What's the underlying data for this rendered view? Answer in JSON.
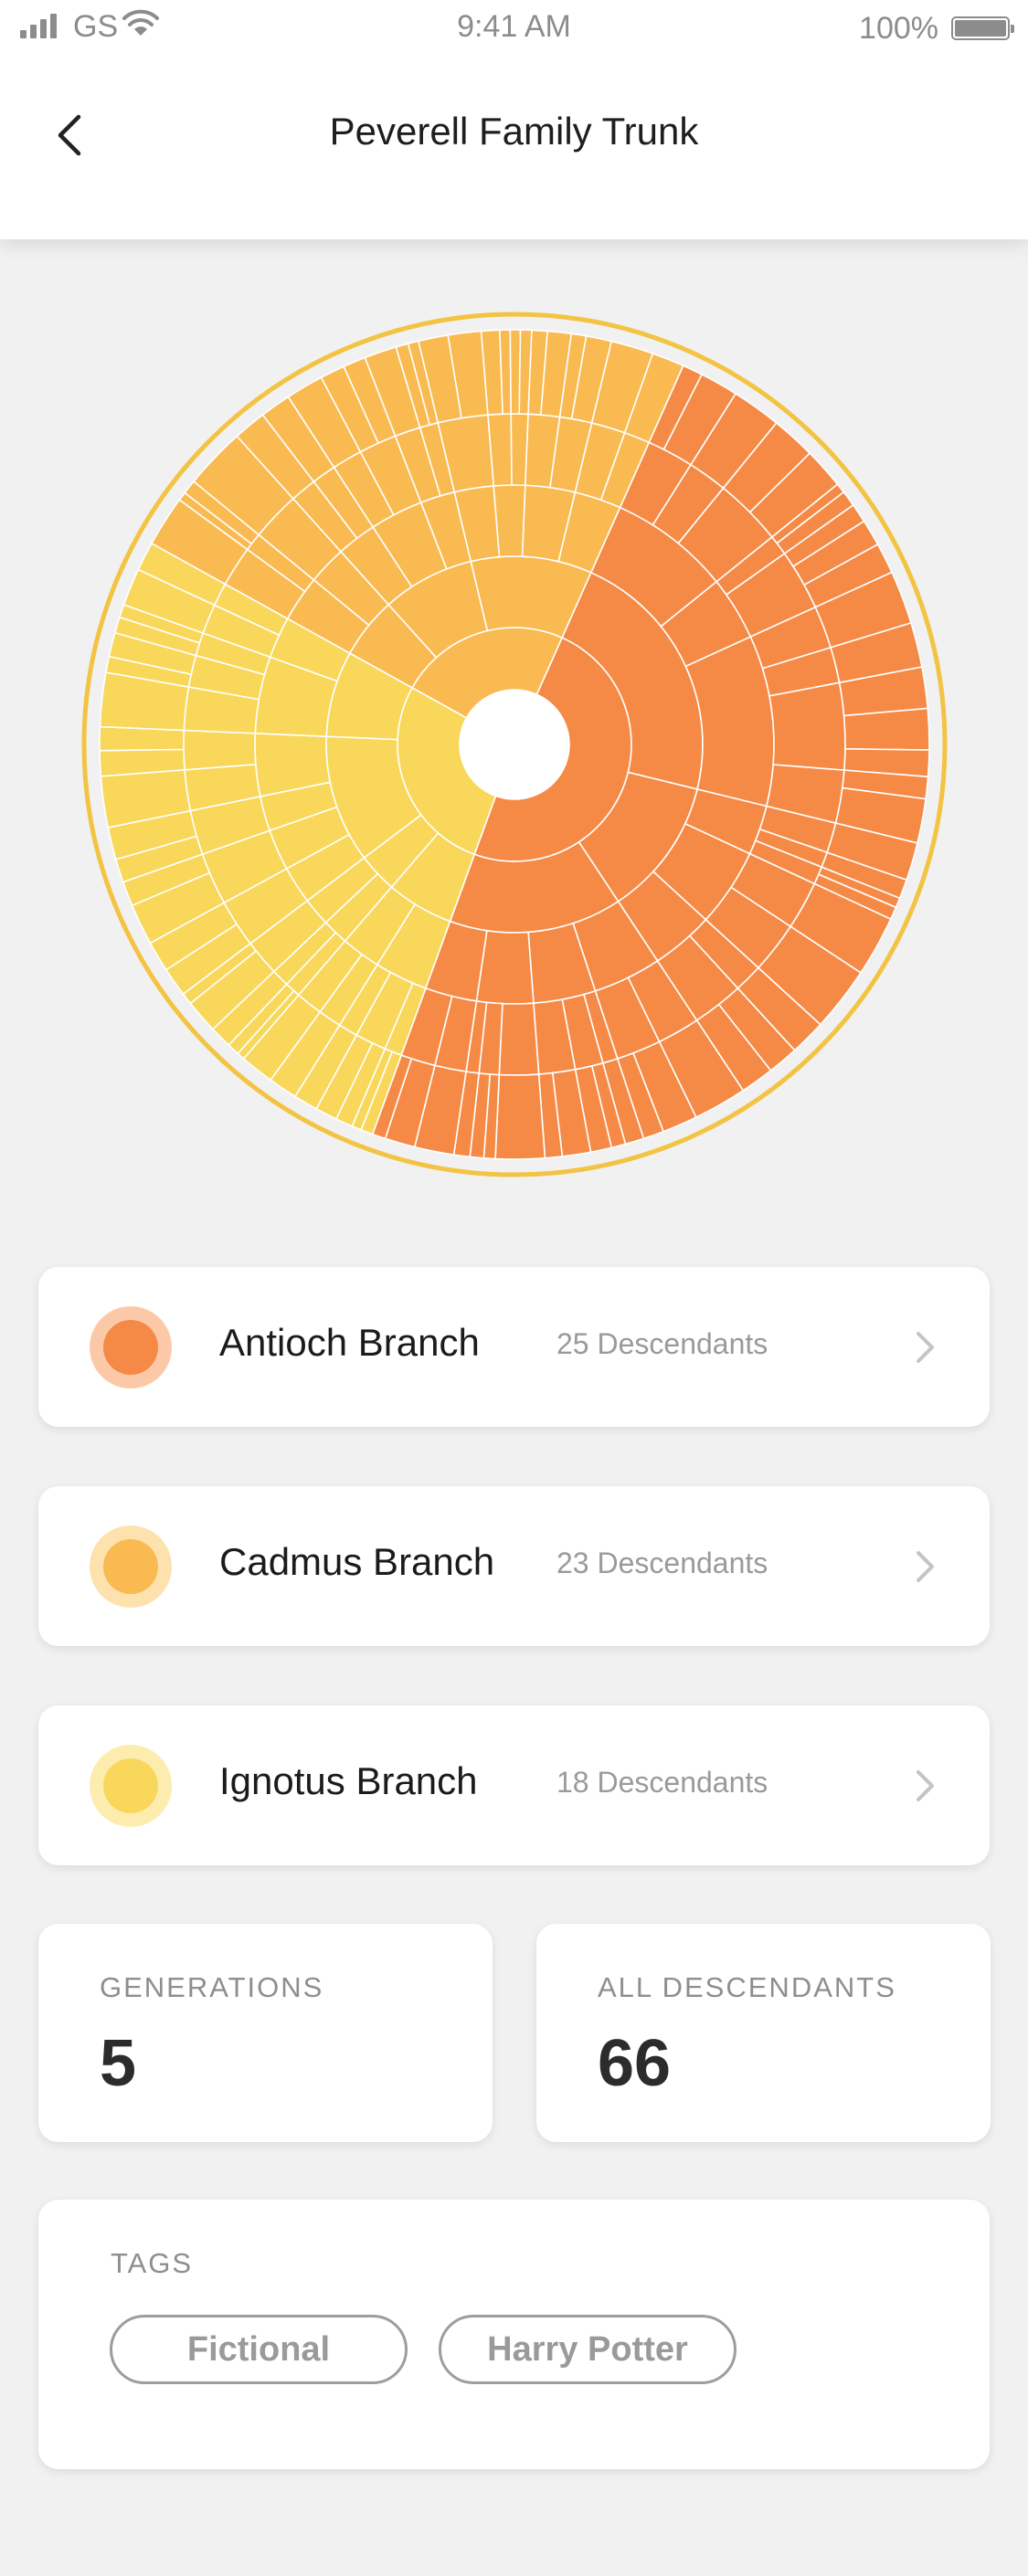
{
  "status_bar": {
    "carrier": "GS",
    "time": "9:41 AM",
    "battery": "100%",
    "battery_level": 1.0
  },
  "header": {
    "title": "Peverell Family Trunk"
  },
  "colors": {
    "antioch": "#F58A47",
    "cadmus": "#F9BA51",
    "ignotus": "#F8D75B",
    "ring": "#F3C343"
  },
  "branches": [
    {
      "name": "Antioch Branch",
      "count": "25 Descendants",
      "color": "#F58A47",
      "halo": "#FCC9A8"
    },
    {
      "name": "Cadmus Branch",
      "count": "23 Descendants",
      "color": "#F9BA51",
      "halo": "#FDE2AE"
    },
    {
      "name": "Ignotus Branch",
      "count": "18 Descendants",
      "color": "#F8D75B",
      "halo": "#FCEDAE"
    }
  ],
  "stats": {
    "generations": {
      "label": "GENERATIONS",
      "value": "5"
    },
    "descendants": {
      "label": "ALL DESCENDANTS",
      "value": "66"
    }
  },
  "tags": {
    "label": "TAGS",
    "items": [
      "Fictional",
      "Harry Potter"
    ]
  },
  "chart_data": {
    "type": "sunburst",
    "center": "blank",
    "rings": 5,
    "branches": [
      {
        "name": "Antioch Branch",
        "descendants": 25,
        "color": "#F58A47",
        "start_deg": 24,
        "end_deg": 200
      },
      {
        "name": "Cadmus Branch",
        "descendants": 23,
        "color": "#F9BA51",
        "start_deg": 299,
        "end_deg": 384
      },
      {
        "name": "Ignotus Branch",
        "descendants": 18,
        "color": "#F8D75B",
        "start_deg": 200,
        "end_deg": 299
      }
    ],
    "outer_ring": "yes"
  }
}
